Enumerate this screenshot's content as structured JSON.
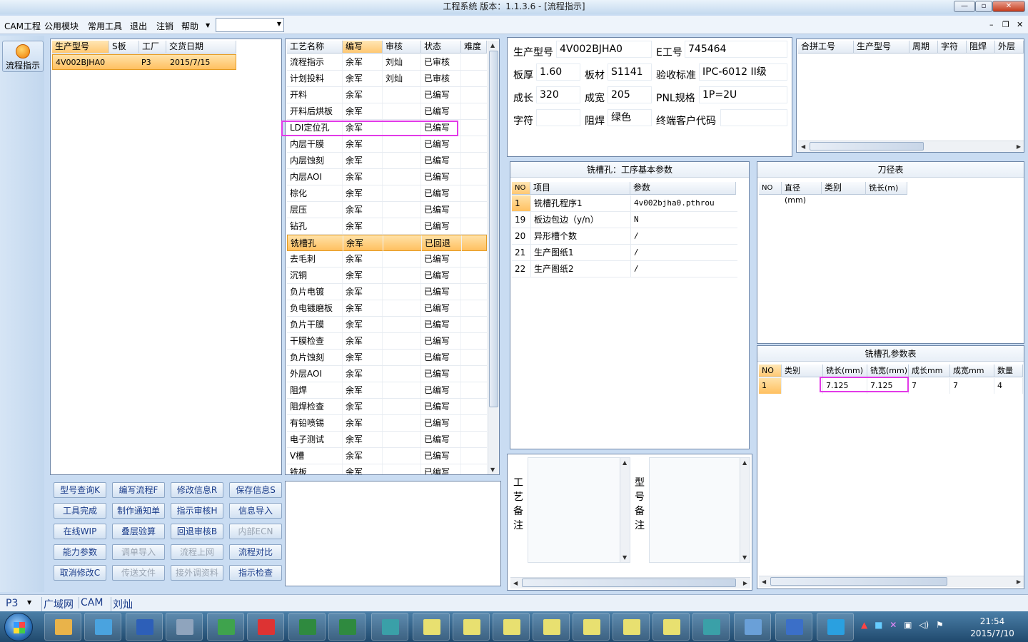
{
  "window": {
    "title": "工程系统  版本：1.1.3.6 - [流程指示]"
  },
  "menu": {
    "items": [
      "CAM工程",
      "公用模块",
      "常用工具",
      "退出",
      "注销",
      "帮助"
    ]
  },
  "nav": {
    "flow_label": "流程指示"
  },
  "model_list": {
    "headers": [
      "生产型号",
      "S板",
      "工厂",
      "交货日期"
    ],
    "row": [
      "4V002BJHA0",
      "",
      "P3",
      "2015/7/15"
    ]
  },
  "process": {
    "headers": [
      "工艺名称",
      "编写",
      "审核",
      "状态",
      "难度"
    ],
    "rows": [
      [
        "流程指示",
        "余军",
        "刘灿",
        "已审核"
      ],
      [
        "计划投料",
        "余军",
        "刘灿",
        "已审核"
      ],
      [
        "开料",
        "余军",
        "",
        "已编写"
      ],
      [
        "开料后烘板",
        "余军",
        "",
        "已编写"
      ],
      [
        "LDI定位孔",
        "余军",
        "",
        "已编写"
      ],
      [
        "内层干膜",
        "余军",
        "",
        "已编写"
      ],
      [
        "内层蚀刻",
        "余军",
        "",
        "已编写"
      ],
      [
        "内层AOI",
        "余军",
        "",
        "已编写"
      ],
      [
        "棕化",
        "余军",
        "",
        "已编写"
      ],
      [
        "层压",
        "余军",
        "",
        "已编写"
      ],
      [
        "钻孔",
        "余军",
        "",
        "已编写"
      ],
      [
        "铣槽孔",
        "余军",
        "",
        "已回退"
      ],
      [
        "去毛刺",
        "余军",
        "",
        "已编写"
      ],
      [
        "沉铜",
        "余军",
        "",
        "已编写"
      ],
      [
        "负片电镀",
        "余军",
        "",
        "已编写"
      ],
      [
        "负电镀磨板",
        "余军",
        "",
        "已编写"
      ],
      [
        "负片干膜",
        "余军",
        "",
        "已编写"
      ],
      [
        "干膜检查",
        "余军",
        "",
        "已编写"
      ],
      [
        "负片蚀刻",
        "余军",
        "",
        "已编写"
      ],
      [
        "外层AOI",
        "余军",
        "",
        "已编写"
      ],
      [
        "阻焊",
        "余军",
        "",
        "已编写"
      ],
      [
        "阻焊检查",
        "余军",
        "",
        "已编写"
      ],
      [
        "有铅喷锡",
        "余军",
        "",
        "已编写"
      ],
      [
        "电子测试",
        "余军",
        "",
        "已编写"
      ],
      [
        "V槽",
        "余军",
        "",
        "已编写"
      ],
      [
        "铣板",
        "余军",
        "",
        "已编写"
      ]
    ]
  },
  "buttons": [
    [
      "型号查询K",
      "编写流程F",
      "修改信息R",
      "保存信息S"
    ],
    [
      "工具完成",
      "制作通知单",
      "指示审核H",
      "信息导入"
    ],
    [
      "在线WIP",
      "叠层验算",
      "回退审核B",
      "内部ECN"
    ],
    [
      "能力参数",
      "调单导入",
      "流程上网",
      "流程对比"
    ],
    [
      "取消修改C",
      "传送文件",
      "接外调资料",
      "指示检查"
    ]
  ],
  "info": {
    "labels": {
      "model": "生产型号",
      "eno": "E工号",
      "thickness": "板厚",
      "material": "板材",
      "standard": "验收标准",
      "length": "成长",
      "width": "成宽",
      "pnl": "PNL规格",
      "char": "字符",
      "mask": "阻焊",
      "customer": "终端客户代码"
    },
    "values": {
      "model": "4V002BJHA0",
      "eno": "745464",
      "thickness": "1.60",
      "material": "S1141",
      "standard": "IPC-6012 II级",
      "length": "320",
      "width": "205",
      "pnl": "1P=2U",
      "char": "",
      "mask": "绿色",
      "customer": ""
    }
  },
  "combine": {
    "headers": [
      "合拼工号",
      "生产型号",
      "周期",
      "字符",
      "阻焊",
      "外层"
    ]
  },
  "params": {
    "title": "铣槽孔：工序基本参数",
    "headers": [
      "NO",
      "项目",
      "参数"
    ],
    "rows": [
      [
        "1",
        "铣槽孔程序1",
        "4v002bjha0.pthrou"
      ],
      [
        "19",
        "板边包边（y/n）",
        "N"
      ],
      [
        "20",
        "异形槽个数",
        "/"
      ],
      [
        "21",
        "生产图纸1",
        "/"
      ],
      [
        "22",
        "生产图纸2",
        "/"
      ]
    ]
  },
  "tools": {
    "title": "刀径表",
    "headers": [
      "NO",
      "直径(mm)",
      "类别",
      "铣长(m)"
    ]
  },
  "slot": {
    "title": "铣槽孔参数表",
    "headers": [
      "NO",
      "类别",
      "铣长(mm)",
      "铣宽(mm)",
      "成长mm",
      "成宽mm",
      "数量"
    ],
    "row": [
      "1",
      "",
      "7.125",
      "7.125",
      "7",
      "7",
      "4"
    ]
  },
  "remarks": {
    "process": "工艺备注",
    "model": "型号备注"
  },
  "status": {
    "factory": "P3",
    "network": "广域网",
    "dept": "CAM",
    "user": "刘灿"
  },
  "clock": {
    "time": "21:54",
    "date": "2015/7/10"
  }
}
